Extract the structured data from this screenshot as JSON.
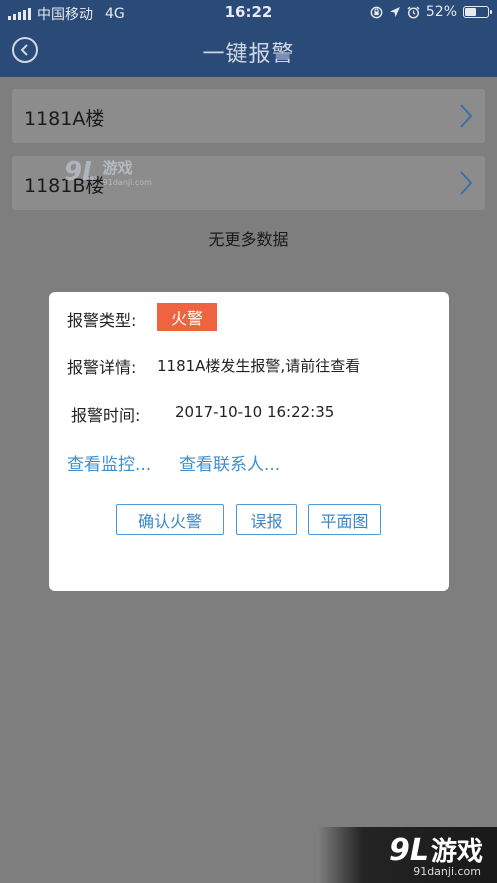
{
  "status_bar": {
    "carrier": "中国移动",
    "network": "4G",
    "time": "16:22",
    "battery": "52%",
    "battery_fraction": 0.52
  },
  "nav": {
    "title": "一键报警"
  },
  "list": {
    "items": [
      {
        "label": "1181A楼"
      },
      {
        "label": "1181B楼"
      }
    ],
    "no_more": "无更多数据"
  },
  "dialog": {
    "type_label": "报警类型:",
    "type_value": "火警",
    "detail_label": "报警详情:",
    "detail_value": "1181A楼发生报警,请前往查看",
    "time_label": "报警时间:",
    "time_value": "2017-10-10 16:22:35",
    "link_monitor": "查看监控...",
    "link_contacts": "查看联系人...",
    "btn_confirm": "确认火警",
    "btn_false": "误报",
    "btn_plan": "平面图"
  },
  "watermark": {
    "logo": "9L",
    "name": "游戏",
    "url": "91danji.com"
  },
  "colors": {
    "nav": "#2a4a78",
    "badge": "#ee6340",
    "link": "#3d8fd0",
    "button_border": "#4f9ad4"
  }
}
